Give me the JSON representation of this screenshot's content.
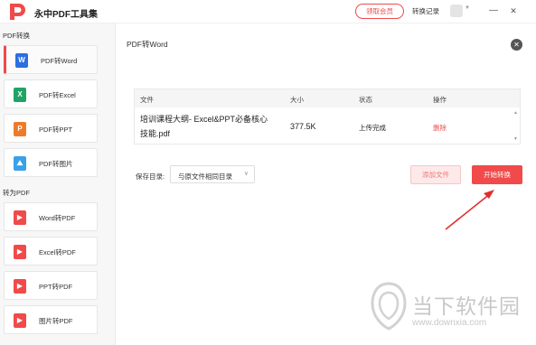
{
  "app": {
    "title": "永中PDF工具集"
  },
  "header": {
    "vip_label": "领取会员",
    "history_label": "转换记录",
    "window_controls": [
      "minimize-icon",
      "maximize-icon",
      "close-icon"
    ]
  },
  "sidebar": {
    "sections": [
      {
        "title": "PDF转换",
        "items": [
          {
            "label": "PDF转Word",
            "icon": "word-icon",
            "glyph": "W",
            "color": "#2b6fe0",
            "active": true
          },
          {
            "label": "PDF转Excel",
            "icon": "excel-icon",
            "glyph": "X",
            "color": "#21a366"
          },
          {
            "label": "PDF转PPT",
            "icon": "ppt-icon",
            "glyph": "P",
            "color": "#f07a28"
          },
          {
            "label": "PDF转图片",
            "icon": "image-icon",
            "glyph": "⛰",
            "color": "#3aa0e8"
          }
        ]
      },
      {
        "title": "转为PDF",
        "items": [
          {
            "label": "Word转PDF",
            "icon": "pdf-icon",
            "glyph": "▶",
            "color": "#f04a4a"
          },
          {
            "label": "Excel转PDF",
            "icon": "pdf-icon",
            "glyph": "▶",
            "color": "#f04a4a"
          },
          {
            "label": "PPT转PDF",
            "icon": "pdf-icon",
            "glyph": "▶",
            "color": "#f04a4a"
          },
          {
            "label": "图片转PDF",
            "icon": "pdf-icon",
            "glyph": "▶",
            "color": "#f04a4a"
          }
        ]
      }
    ]
  },
  "main": {
    "title": "PDF转Word",
    "table": {
      "headers": [
        "文件",
        "大小",
        "状态",
        "操作"
      ],
      "rows": [
        {
          "file_line1": "培训课程大纲- Excel&PPT必备核心",
          "file_line2": "技能.pdf",
          "size": "377.5K",
          "status": "上传完成",
          "action": "删除"
        }
      ]
    },
    "save_dir_label": "保存目录:",
    "save_dir_value": "与原文件相同目录",
    "add_file_label": "添加文件",
    "start_label": "开始转换"
  },
  "watermark": {
    "text": "当下软件园",
    "url": "www.downxia.com"
  },
  "colors": {
    "accent": "#f04a4a"
  }
}
